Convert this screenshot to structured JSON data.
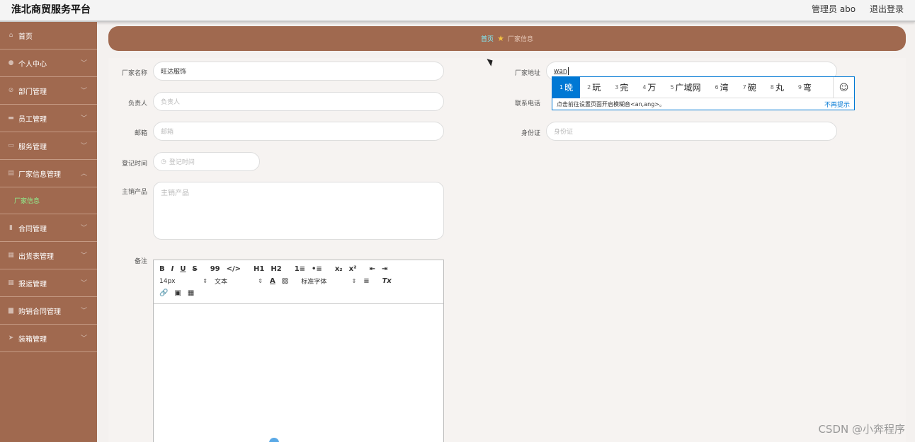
{
  "app": {
    "title": "淮北商贸服务平台"
  },
  "header": {
    "admin_label": "管理员 abo",
    "logout_label": "退出登录"
  },
  "sidebar": {
    "items": [
      {
        "label": "首页",
        "icon": "home-icon"
      },
      {
        "label": "个人中心",
        "icon": "user-icon"
      },
      {
        "label": "部门管理",
        "icon": "settings-icon"
      },
      {
        "label": "员工管理",
        "icon": "briefcase-icon"
      },
      {
        "label": "服务管理",
        "icon": "card-icon"
      },
      {
        "label": "厂家信息管理",
        "icon": "document-icon"
      },
      {
        "label": "合同管理",
        "icon": "bar-chart-icon"
      },
      {
        "label": "出货表管理",
        "icon": "grid-icon"
      },
      {
        "label": "报运管理",
        "icon": "table-icon"
      },
      {
        "label": "购销合同管理",
        "icon": "folder-icon"
      },
      {
        "label": "装箱管理",
        "icon": "send-icon"
      }
    ],
    "sub_items": [
      {
        "label": "厂家信息"
      }
    ]
  },
  "breadcrumb": {
    "home": "首页",
    "current": "厂家信息"
  },
  "form": {
    "factory_name": {
      "label": "厂家名称",
      "value": "旺达服饰"
    },
    "factory_address": {
      "label": "厂家地址",
      "value": "wan"
    },
    "owner": {
      "label": "负责人",
      "placeholder": "负责人"
    },
    "phone": {
      "label": "联系电话"
    },
    "email": {
      "label": "邮箱",
      "placeholder": "邮箱"
    },
    "id_card": {
      "label": "身份证",
      "placeholder": "身份证"
    },
    "register_time": {
      "label": "登记时间",
      "placeholder": "登记时间"
    },
    "main_products": {
      "label": "主销产品",
      "placeholder": "主销产品"
    },
    "remarks": {
      "label": "备注"
    }
  },
  "editor": {
    "toolbar_row1": [
      "B",
      "I",
      "U",
      "S",
      "99",
      "</>",
      "H1",
      "H2",
      "1≡",
      "•≡",
      "x₂",
      "x²",
      "⇤",
      "⇥"
    ],
    "font_size": "14px",
    "text_style": "文本",
    "font_family": "标准字体"
  },
  "ime": {
    "candidates": [
      {
        "n": "1",
        "text": "晚"
      },
      {
        "n": "2",
        "text": "玩"
      },
      {
        "n": "3",
        "text": "完"
      },
      {
        "n": "4",
        "text": "万"
      },
      {
        "n": "5",
        "text": "广域网"
      },
      {
        "n": "6",
        "text": "湾"
      },
      {
        "n": "7",
        "text": "碗"
      },
      {
        "n": "8",
        "text": "丸"
      },
      {
        "n": "9",
        "text": "弯"
      }
    ],
    "tip": "点击前往设置页面开启模糊音<an,ang>。",
    "dismiss": "不再提示"
  },
  "watermark": "CSDN @小奔程序"
}
